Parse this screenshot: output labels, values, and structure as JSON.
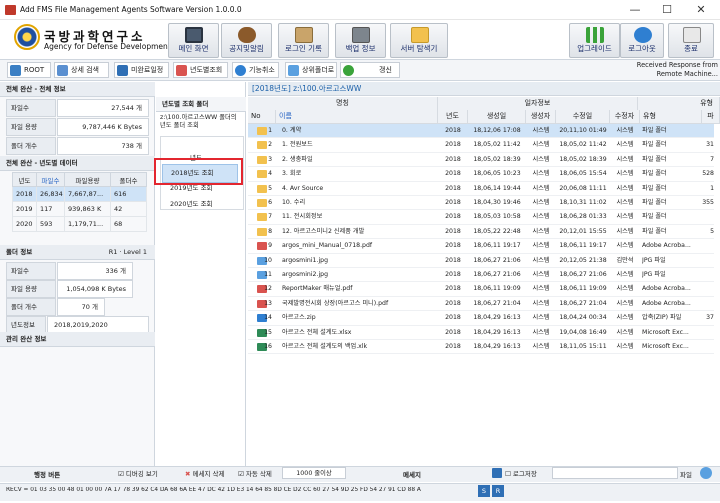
{
  "window": {
    "title": "Add FMS File Management Agents Software Version 1.0.0.0",
    "min": "—",
    "max": "☐",
    "close": "✕"
  },
  "banner": {
    "org_ko": "국방과학연구소",
    "org_en": "Agency for Defense Development",
    "left_buttons": [
      "메인 화면",
      "공지및알림",
      "로그인 기록",
      "백업 정보",
      "서버 탐색기"
    ],
    "right_buttons": [
      "업그레이드",
      "로그아웃",
      "종료"
    ]
  },
  "toolbar": {
    "buttons": [
      "ROOT",
      "상세 검색",
      "미완료일정",
      "년도별조회",
      "기능취소",
      "상위폴더로",
      "갱신"
    ],
    "status_message": "Received Response from Remote Machine..."
  },
  "left": {
    "all_info_title": "전체 완산 - 전체 정보",
    "all_info": [
      {
        "label": "파일수",
        "value": "27,544",
        "unit": "개"
      },
      {
        "label": "파일 용량",
        "value": "9,787,446 K",
        "unit": "Bytes"
      },
      {
        "label": "폴더 개수",
        "value": "738",
        "unit": "개"
      }
    ],
    "year_title": "전체 완산 - 년도별 데이터",
    "year_headers": [
      "년도",
      "파일수",
      "파일용량",
      "폴더수"
    ],
    "year_rows": [
      [
        "2018",
        "26,834",
        "7,667,87...",
        "616"
      ],
      [
        "2019",
        "117",
        "939,863 K",
        "42"
      ],
      [
        "2020",
        "593",
        "1,179,71...",
        "68"
      ]
    ],
    "folder_title": "폴더 정보",
    "folder_level": "R1 · Level 1",
    "folder_info": [
      {
        "label": "파일수",
        "value": "336",
        "unit": "개"
      },
      {
        "label": "파일 용량",
        "value": "1,054,098 K",
        "unit": "Bytes"
      },
      {
        "label": "폴더 개수",
        "value": "70",
        "unit": "개"
      },
      {
        "label": "년도정보",
        "value": "2018,2019,2020",
        "unit": ""
      }
    ],
    "mgmt_title": "관리 완산 정보"
  },
  "tree": {
    "title": "년도별 조회 폴더",
    "path": "z:\\100.아르고스WW 폴더의 년도 폴더 조회",
    "group_label": "년도",
    "items": [
      "2018년도 조회",
      "2019년도 조회",
      "2020년도 조회"
    ]
  },
  "grid": {
    "path": "[2018년도] z:\\100.아르고스WW",
    "group_headers": [
      "명칭",
      "일자정보",
      "유형"
    ],
    "columns": [
      "No",
      "이름",
      "년도",
      "생성일",
      "생성자",
      "수정일",
      "수정자",
      "유형",
      "파"
    ],
    "rows": [
      {
        "no": "1",
        "name": "0. 계약",
        "year": "2018",
        "created": "18,12,06 17:08",
        "creator": "시스템",
        "modified": "20,11,10 01:49",
        "modifier": "시스템",
        "type": "파일 폴더",
        "extra": "",
        "icon": "folder"
      },
      {
        "no": "2",
        "name": "1. 전원보드",
        "year": "2018",
        "created": "18,05,02 11:42",
        "creator": "시스템",
        "modified": "18,05,02 11:42",
        "modifier": "시스템",
        "type": "파일 폴더",
        "extra": "31",
        "icon": "folder"
      },
      {
        "no": "3",
        "name": "2. 생충파일",
        "year": "2018",
        "created": "18,05,02 18:39",
        "creator": "시스템",
        "modified": "18,05,02 18:39",
        "modifier": "시스템",
        "type": "파일 폴더",
        "extra": "7",
        "icon": "folder"
      },
      {
        "no": "4",
        "name": "3. 회로",
        "year": "2018",
        "created": "18,06,05 10:23",
        "creator": "시스템",
        "modified": "18,06,05 15:54",
        "modifier": "시스템",
        "type": "파일 폴더",
        "extra": "528",
        "icon": "folder"
      },
      {
        "no": "5",
        "name": "4. Avr Source",
        "year": "2018",
        "created": "18,06,14 19:44",
        "creator": "시스템",
        "modified": "20,06,08 11:11",
        "modifier": "시스템",
        "type": "파일 폴더",
        "extra": "1",
        "icon": "folder"
      },
      {
        "no": "6",
        "name": "10. 수리",
        "year": "2018",
        "created": "18,04,30 19:46",
        "creator": "시스템",
        "modified": "18,10,31 11:02",
        "modifier": "시스템",
        "type": "파일 폴더",
        "extra": "355",
        "icon": "folder"
      },
      {
        "no": "7",
        "name": "11. 전시회정보",
        "year": "2018",
        "created": "18,05,03 10:58",
        "creator": "시스템",
        "modified": "18,06,28 01:33",
        "modifier": "시스템",
        "type": "파일 폴더",
        "extra": "",
        "icon": "folder"
      },
      {
        "no": "8",
        "name": "12. 아르고스미니2 신제품 개발",
        "year": "2018",
        "created": "18,05,22 22:48",
        "creator": "시스템",
        "modified": "20,12,01 15:55",
        "modifier": "시스템",
        "type": "파일 폴더",
        "extra": "5",
        "icon": "folder"
      },
      {
        "no": "9",
        "name": "argos_mini_Manual_0718.pdf",
        "year": "2018",
        "created": "18,06,11 19:17",
        "creator": "시스템",
        "modified": "18,06,11 19:17",
        "modifier": "시스템",
        "type": "Adobe Acroba...",
        "extra": "",
        "icon": "pdf"
      },
      {
        "no": "10",
        "name": "argosmini1.jpg",
        "year": "2018",
        "created": "18,06,27 21:06",
        "creator": "시스템",
        "modified": "20,12,05 21:38",
        "modifier": "김만석",
        "type": "JPG 파일",
        "extra": "",
        "icon": "img"
      },
      {
        "no": "11",
        "name": "argosmini2.jpg",
        "year": "2018",
        "created": "18,06,27 21:06",
        "creator": "시스템",
        "modified": "18,06,27 21:06",
        "modifier": "시스템",
        "type": "JPG 파일",
        "extra": "",
        "icon": "img"
      },
      {
        "no": "12",
        "name": "ReportMaker 매뉴얼.pdf",
        "year": "2018",
        "created": "18,06,11 19:09",
        "creator": "시스템",
        "modified": "18,06,11 19:09",
        "modifier": "시스템",
        "type": "Adobe Acroba...",
        "extra": "",
        "icon": "pdf"
      },
      {
        "no": "13",
        "name": "국제발명전시회 상장(아르고스 미니).pdf",
        "year": "2018",
        "created": "18,06,27 21:04",
        "creator": "시스템",
        "modified": "18,06,27 21:04",
        "modifier": "시스템",
        "type": "Adobe Acroba...",
        "extra": "",
        "icon": "pdf"
      },
      {
        "no": "14",
        "name": "아르고스.zip",
        "year": "2018",
        "created": "18,04,29 16:13",
        "creator": "시스템",
        "modified": "18,04,24 00:34",
        "modifier": "시스템",
        "type": "압축(ZIP) 파일",
        "extra": "37",
        "icon": "zip"
      },
      {
        "no": "15",
        "name": "아르고스 전체 설계도.xlsx",
        "year": "2018",
        "created": "18,04,29 16:13",
        "creator": "시스템",
        "modified": "19,04,08 16:49",
        "modifier": "시스템",
        "type": "Microsoft Exc...",
        "extra": "",
        "icon": "xls"
      },
      {
        "no": "16",
        "name": "아르고스 전체 설계도의 백업.xlk",
        "year": "2018",
        "created": "18,04,29 16:13",
        "creator": "시스템",
        "modified": "18,11,05 15:11",
        "modifier": "시스템",
        "type": "Microsoft Exc...",
        "extra": "",
        "icon": "xlk"
      }
    ]
  },
  "statusbar": {
    "left": "행정 버튼",
    "debug_label": "디버깅 보기",
    "delete_msg": "메세지 삭제",
    "auto_delete": "자동 삭제",
    "count": "1000 줄이상",
    "message_label": "메세지",
    "log_save": "로그저장",
    "file_label": "파일",
    "recv": "RECV = 01 03 35 00 48 01 00 00 7A 17 78 39 62 C4 DA 68 6A EE 47 DC 42 1D E3 14 64 85 8D CE D2 CC 60 27 54 9D 25 FD 54 27 91 CD 88 A",
    "send": "S",
    "recv_short": "R"
  },
  "colors": {
    "accent_highlight": "#e3262f",
    "selection": "#cfe3f7",
    "header_bg": "#e9edf2"
  }
}
